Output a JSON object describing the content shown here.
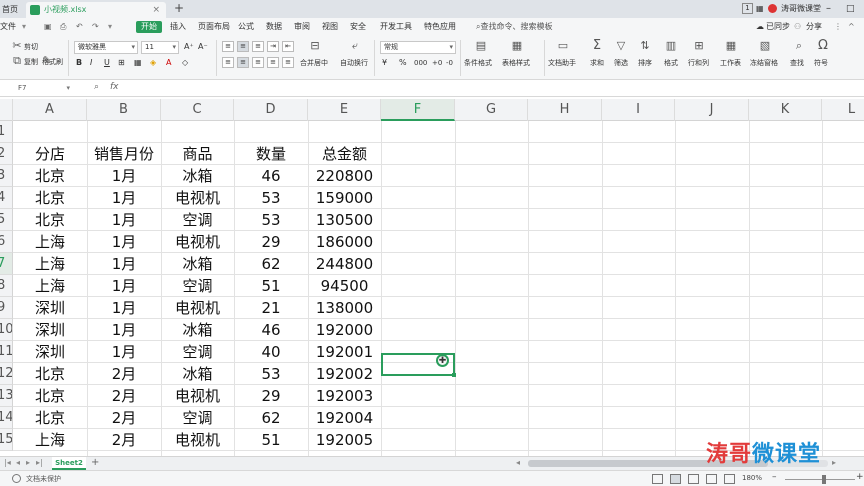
{
  "titlebar": {
    "home_tab": "首页",
    "file_tab": "小视频.xlsx",
    "new_tab": "+",
    "account_badge": "1",
    "account_name": "涛哥微课堂"
  },
  "menubar": {
    "file": "文件",
    "items": [
      "开始",
      "插入",
      "页面布局",
      "公式",
      "数据",
      "审阅",
      "视图",
      "安全",
      "开发工具",
      "特色应用"
    ],
    "search": "查找命令、搜索模板",
    "synced": "已同步",
    "share": "分享"
  },
  "ribbon": {
    "cut": "剪切",
    "copy": "复制",
    "format_painter": "格式刷",
    "font_name": "微软雅黑",
    "font_size": "11",
    "merge_center": "合并居中",
    "wrap": "自动换行",
    "number_format": "常规",
    "percent": "%",
    "cond_format": "条件格式",
    "table_style": "表格样式",
    "doc_helper": "文档助手",
    "sum": "求和",
    "filter": "筛选",
    "sort": "排序",
    "format": "格式",
    "rows_cols": "行和列",
    "worksheet": "工作表",
    "freeze": "冻结窗格",
    "find": "查找",
    "symbol": "符号"
  },
  "formula_bar": {
    "cell_ref": "F7",
    "fx": "fx"
  },
  "grid": {
    "columns": [
      "A",
      "B",
      "C",
      "D",
      "E",
      "F",
      "G",
      "H",
      "I",
      "J",
      "K",
      "L"
    ],
    "row_numbers": [
      "1",
      "2",
      "3",
      "4",
      "5",
      "6",
      "7",
      "8",
      "9",
      "10",
      "11",
      "12",
      "13",
      "14",
      "15"
    ],
    "header": [
      "分店",
      "销售月份",
      "商品",
      "数量",
      "总金额"
    ],
    "rows": [
      [
        "北京",
        "1月",
        "冰箱",
        "46",
        "220800"
      ],
      [
        "北京",
        "1月",
        "电视机",
        "53",
        "159000"
      ],
      [
        "北京",
        "1月",
        "空调",
        "53",
        "130500"
      ],
      [
        "上海",
        "1月",
        "电视机",
        "29",
        "186000"
      ],
      [
        "上海",
        "1月",
        "冰箱",
        "62",
        "244800"
      ],
      [
        "上海",
        "1月",
        "空调",
        "51",
        "94500"
      ],
      [
        "深圳",
        "1月",
        "电视机",
        "21",
        "138000"
      ],
      [
        "深圳",
        "1月",
        "冰箱",
        "46",
        "192000"
      ],
      [
        "深圳",
        "1月",
        "空调",
        "40",
        "192001"
      ],
      [
        "北京",
        "2月",
        "冰箱",
        "53",
        "192002"
      ],
      [
        "北京",
        "2月",
        "电视机",
        "29",
        "192003"
      ],
      [
        "北京",
        "2月",
        "空调",
        "62",
        "192004"
      ],
      [
        "上海",
        "2月",
        "电视机",
        "51",
        "192005"
      ]
    ],
    "selected_column": "F",
    "selected_row": "7"
  },
  "sheets": {
    "active": "Sheet2",
    "add": "+"
  },
  "statusbar": {
    "protection": "文档未保护",
    "zoom": "180%"
  },
  "watermark": {
    "part1": "涛哥",
    "part2": "微课堂"
  },
  "colors": {
    "accent": "#2a9d5c",
    "watermark_red": "#e23b3b",
    "watermark_blue": "#1e90d6"
  }
}
